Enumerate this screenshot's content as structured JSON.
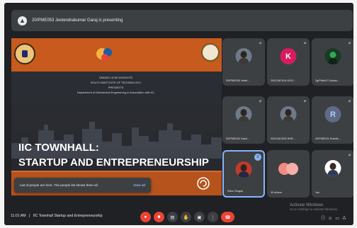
{
  "presenting_bar": {
    "text": "20/PME053 Jeetendrakumar Garaj is presenting",
    "icon": "present-screen-icon"
  },
  "slide": {
    "lines": [
      "ONKAR LICSH INSIGHTS",
      "SOUTH INSTITUTE OF TECHNOLOGY",
      "PRESENTS",
      "Department of Mechanical Engineering in Association with IIC"
    ],
    "title_line1": "IIC TOWNHALL:",
    "title_line2": "STARTUP AND ENTREPRENEURSHIP",
    "colors": {
      "accent": "#c85a1e",
      "title": "#ffffff"
    }
  },
  "toast": {
    "message": "List of people are here. The people list shows them all",
    "action": "View all"
  },
  "participants": [
    {
      "name": "20/PME053 Jeete...",
      "avatar": "photo",
      "mic": "muted"
    },
    {
      "name": "20GCMCK04 KOO...",
      "avatar": "K",
      "mic": "muted"
    },
    {
      "name": "2g/PMe017 Ashok...",
      "avatar": "dark",
      "mic": "muted"
    },
    {
      "name": "20/PME042 Gauri...",
      "avatar": "photo",
      "mic": "muted"
    },
    {
      "name": "20GCMCK05 SHR...",
      "avatar": "photo",
      "mic": "muted"
    },
    {
      "name": "20/PME021 Rushik...",
      "avatar": "R",
      "mic": "muted"
    },
    {
      "name": "Ritoo Tongad",
      "avatar": "red",
      "mic": "speaking"
    },
    {
      "name": "33 others",
      "avatar": "group",
      "mic": ""
    },
    {
      "name": "You",
      "avatar": "white",
      "mic": "muted"
    }
  ],
  "bottom_bar": {
    "time": "11:01 AM",
    "separator": "|",
    "meeting_title": "IIC Townhall Startup and Entrepreneurship",
    "controls": [
      "mic-off-icon",
      "camera-off-icon",
      "captions-icon",
      "raise-hand-icon",
      "present-icon",
      "more-options-icon",
      "end-call-icon"
    ],
    "right_icons": [
      "info-icon",
      "people-icon",
      "chat-icon",
      "activities-icon"
    ]
  },
  "watermark": {
    "line1": "Activate Windows",
    "line2": "Go to Settings to activate Windows."
  }
}
